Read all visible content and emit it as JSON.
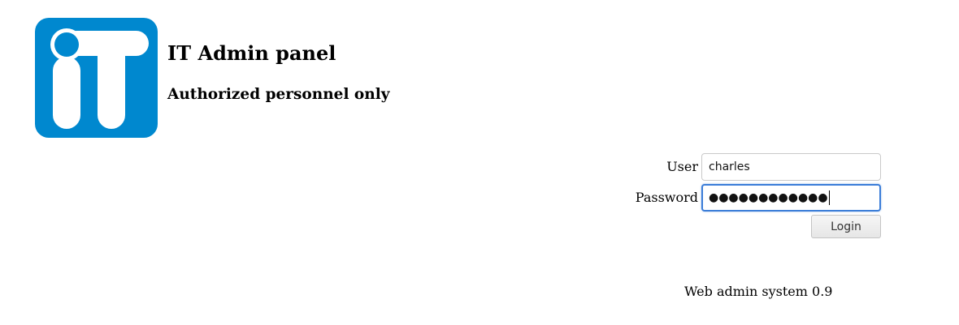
{
  "header": {
    "title": "IT Admin panel",
    "subtitle": "Authorized personnel only"
  },
  "logo": {
    "icon": "it-logo",
    "color": "#0088cf"
  },
  "login_form": {
    "user_label": "User",
    "user_value": "charles",
    "password_label": "Password",
    "password_masked": "●●●●●●●●●●●●",
    "login_label": "Login",
    "focus_color": "#3b7dd8"
  },
  "footer": {
    "text": "Web admin system 0.9"
  }
}
